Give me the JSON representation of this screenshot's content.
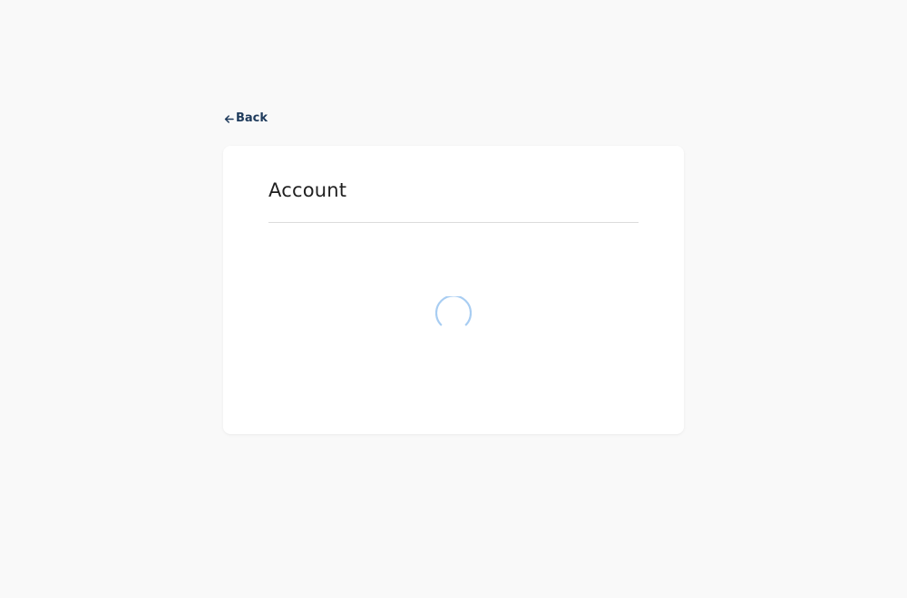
{
  "nav": {
    "back_label": "Back",
    "back_icon": "arrow-left-icon"
  },
  "card": {
    "title": "Account",
    "loading_icon": "spinner-icon"
  },
  "colors": {
    "background": "#f9f9f9",
    "card": "#ffffff",
    "link": "#1f3b5c",
    "title": "#1f1f1f",
    "divider": "#dcdcdc",
    "spinner": "#a8cdf2"
  }
}
